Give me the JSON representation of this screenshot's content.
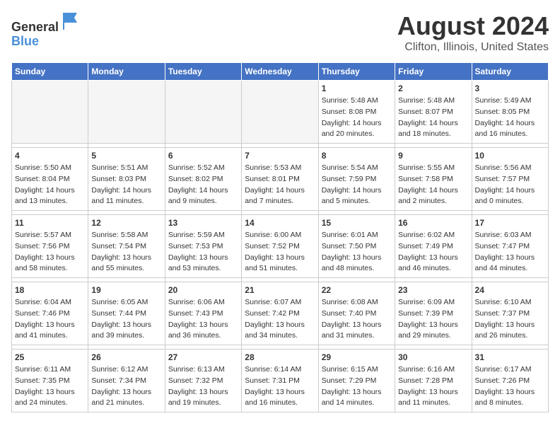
{
  "header": {
    "logo_line1": "General",
    "logo_line2": "Blue",
    "main_title": "August 2024",
    "subtitle": "Clifton, Illinois, United States"
  },
  "calendar": {
    "days_of_week": [
      "Sunday",
      "Monday",
      "Tuesday",
      "Wednesday",
      "Thursday",
      "Friday",
      "Saturday"
    ],
    "weeks": [
      [
        {
          "day": "",
          "info": ""
        },
        {
          "day": "",
          "info": ""
        },
        {
          "day": "",
          "info": ""
        },
        {
          "day": "",
          "info": ""
        },
        {
          "day": "1",
          "info": "Sunrise: 5:48 AM\nSunset: 8:08 PM\nDaylight: 14 hours\nand 20 minutes."
        },
        {
          "day": "2",
          "info": "Sunrise: 5:48 AM\nSunset: 8:07 PM\nDaylight: 14 hours\nand 18 minutes."
        },
        {
          "day": "3",
          "info": "Sunrise: 5:49 AM\nSunset: 8:05 PM\nDaylight: 14 hours\nand 16 minutes."
        }
      ],
      [
        {
          "day": "4",
          "info": "Sunrise: 5:50 AM\nSunset: 8:04 PM\nDaylight: 14 hours\nand 13 minutes."
        },
        {
          "day": "5",
          "info": "Sunrise: 5:51 AM\nSunset: 8:03 PM\nDaylight: 14 hours\nand 11 minutes."
        },
        {
          "day": "6",
          "info": "Sunrise: 5:52 AM\nSunset: 8:02 PM\nDaylight: 14 hours\nand 9 minutes."
        },
        {
          "day": "7",
          "info": "Sunrise: 5:53 AM\nSunset: 8:01 PM\nDaylight: 14 hours\nand 7 minutes."
        },
        {
          "day": "8",
          "info": "Sunrise: 5:54 AM\nSunset: 7:59 PM\nDaylight: 14 hours\nand 5 minutes."
        },
        {
          "day": "9",
          "info": "Sunrise: 5:55 AM\nSunset: 7:58 PM\nDaylight: 14 hours\nand 2 minutes."
        },
        {
          "day": "10",
          "info": "Sunrise: 5:56 AM\nSunset: 7:57 PM\nDaylight: 14 hours\nand 0 minutes."
        }
      ],
      [
        {
          "day": "11",
          "info": "Sunrise: 5:57 AM\nSunset: 7:56 PM\nDaylight: 13 hours\nand 58 minutes."
        },
        {
          "day": "12",
          "info": "Sunrise: 5:58 AM\nSunset: 7:54 PM\nDaylight: 13 hours\nand 55 minutes."
        },
        {
          "day": "13",
          "info": "Sunrise: 5:59 AM\nSunset: 7:53 PM\nDaylight: 13 hours\nand 53 minutes."
        },
        {
          "day": "14",
          "info": "Sunrise: 6:00 AM\nSunset: 7:52 PM\nDaylight: 13 hours\nand 51 minutes."
        },
        {
          "day": "15",
          "info": "Sunrise: 6:01 AM\nSunset: 7:50 PM\nDaylight: 13 hours\nand 48 minutes."
        },
        {
          "day": "16",
          "info": "Sunrise: 6:02 AM\nSunset: 7:49 PM\nDaylight: 13 hours\nand 46 minutes."
        },
        {
          "day": "17",
          "info": "Sunrise: 6:03 AM\nSunset: 7:47 PM\nDaylight: 13 hours\nand 44 minutes."
        }
      ],
      [
        {
          "day": "18",
          "info": "Sunrise: 6:04 AM\nSunset: 7:46 PM\nDaylight: 13 hours\nand 41 minutes."
        },
        {
          "day": "19",
          "info": "Sunrise: 6:05 AM\nSunset: 7:44 PM\nDaylight: 13 hours\nand 39 minutes."
        },
        {
          "day": "20",
          "info": "Sunrise: 6:06 AM\nSunset: 7:43 PM\nDaylight: 13 hours\nand 36 minutes."
        },
        {
          "day": "21",
          "info": "Sunrise: 6:07 AM\nSunset: 7:42 PM\nDaylight: 13 hours\nand 34 minutes."
        },
        {
          "day": "22",
          "info": "Sunrise: 6:08 AM\nSunset: 7:40 PM\nDaylight: 13 hours\nand 31 minutes."
        },
        {
          "day": "23",
          "info": "Sunrise: 6:09 AM\nSunset: 7:39 PM\nDaylight: 13 hours\nand 29 minutes."
        },
        {
          "day": "24",
          "info": "Sunrise: 6:10 AM\nSunset: 7:37 PM\nDaylight: 13 hours\nand 26 minutes."
        }
      ],
      [
        {
          "day": "25",
          "info": "Sunrise: 6:11 AM\nSunset: 7:35 PM\nDaylight: 13 hours\nand 24 minutes."
        },
        {
          "day": "26",
          "info": "Sunrise: 6:12 AM\nSunset: 7:34 PM\nDaylight: 13 hours\nand 21 minutes."
        },
        {
          "day": "27",
          "info": "Sunrise: 6:13 AM\nSunset: 7:32 PM\nDaylight: 13 hours\nand 19 minutes."
        },
        {
          "day": "28",
          "info": "Sunrise: 6:14 AM\nSunset: 7:31 PM\nDaylight: 13 hours\nand 16 minutes."
        },
        {
          "day": "29",
          "info": "Sunrise: 6:15 AM\nSunset: 7:29 PM\nDaylight: 13 hours\nand 14 minutes."
        },
        {
          "day": "30",
          "info": "Sunrise: 6:16 AM\nSunset: 7:28 PM\nDaylight: 13 hours\nand 11 minutes."
        },
        {
          "day": "31",
          "info": "Sunrise: 6:17 AM\nSunset: 7:26 PM\nDaylight: 13 hours\nand 8 minutes."
        }
      ]
    ]
  }
}
